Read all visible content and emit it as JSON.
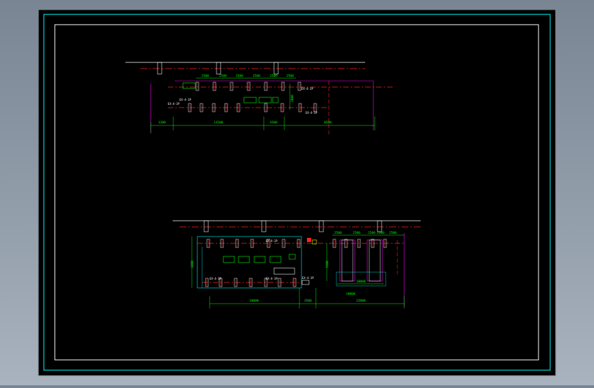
{
  "drawing": {
    "top_plan": {
      "dimensions_top": [
        "2500",
        "2500",
        "2500",
        "2500",
        "2500",
        "2500"
      ],
      "dimensions_bottom": [
        "1200",
        "13500",
        "4500",
        "8500"
      ],
      "vertical_dimension": "3800",
      "labels": [
        "EX-4-1P",
        "EX-4-1P",
        "EX-4-1P",
        "EX-4-1P"
      ],
      "boxes": [
        "B",
        "B",
        "B"
      ]
    },
    "bottom_plan": {
      "dimensions_top": [
        "2500",
        "2500",
        "2500",
        "2500",
        "2500"
      ],
      "dimensions_bottom": [
        "10000",
        "3500",
        "22000"
      ],
      "center_dimension": "10000",
      "left_vertical": "3200",
      "right_vertical": "5500",
      "labels": [
        "EX-4-1P",
        "EX-4-1P",
        "EX-4-1P",
        "EX-4-1P"
      ],
      "boxes": [
        "B",
        "B",
        "B",
        "B",
        "B",
        "B"
      ]
    }
  }
}
